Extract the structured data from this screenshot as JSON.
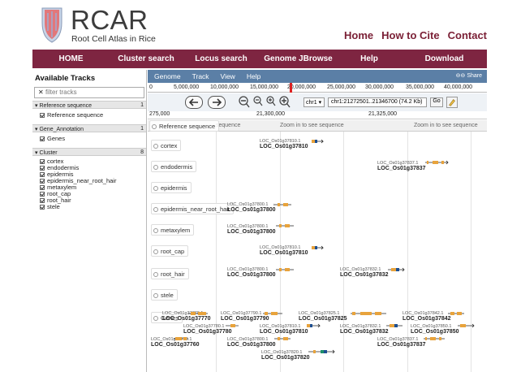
{
  "header": {
    "brand_title": "RCAR",
    "brand_subtitle": "Root Cell Atlas in Rice",
    "links": [
      "Home",
      "How to Cite",
      "Contact"
    ]
  },
  "nav": {
    "items": [
      "HOME",
      "Cluster search",
      "Locus search",
      "Genome JBrowse",
      "Help",
      "Download"
    ]
  },
  "tracks_panel": {
    "title": "Available Tracks",
    "filter_placeholder": "filter tracks",
    "categories": [
      {
        "name": "Reference sequence",
        "count": "1",
        "items": [
          "Reference sequence"
        ]
      },
      {
        "name": "Gene_Annotation",
        "count": "1",
        "items": [
          "Genes"
        ]
      },
      {
        "name": "Cluster",
        "count": "8",
        "items": [
          "cortex",
          "endodermis",
          "epidermis",
          "epidermis_near_root_hair",
          "metaxylem",
          "root_cap",
          "root_hair",
          "stele"
        ]
      }
    ]
  },
  "browser": {
    "menu": [
      "Genome",
      "Track",
      "View",
      "Help"
    ],
    "share_label": "Share",
    "overview_ticks": [
      "0",
      "5,000,000",
      "10,000,000",
      "15,000,000",
      "20,000,000",
      "25,000,000",
      "30,000,000",
      "35,000,000",
      "40,000,000"
    ],
    "chromosome": "chr1",
    "location": "chr1:21272501..21346700 (74.2 Kb)",
    "go_label": "Go",
    "ruler_ticks": [
      "275,000",
      "21,300,000",
      "21,325,000"
    ],
    "ref_row": {
      "label": "Reference sequence",
      "messages": [
        "sequence",
        "Zoom in to see sequence",
        "Zoom in to see sequence"
      ]
    },
    "tracks": [
      {
        "label": "cortex",
        "genes": [
          {
            "small": "LOC_Os01g37810.1",
            "big": "LOC_Os01g37810"
          }
        ]
      },
      {
        "label": "endodermis",
        "genes": [
          {
            "small": "LOC_Os01g37837.1",
            "big": "LOC_Os01g37837"
          }
        ]
      },
      {
        "label": "epidermis",
        "genes": []
      },
      {
        "label": "epidermis_near_root_hair",
        "genes": [
          {
            "small": "LOC_Os01g37800.1",
            "big": "LOC_Os01g37800"
          }
        ]
      },
      {
        "label": "metaxylem",
        "genes": [
          {
            "small": "LOC_Os01g37800.1",
            "big": "LOC_Os01g37800"
          }
        ]
      },
      {
        "label": "root_cap",
        "genes": [
          {
            "small": "LOC_Os01g37810.1",
            "big": "LOC_Os01g37810"
          }
        ]
      },
      {
        "label": "root_hair",
        "genes": [
          {
            "small": "LOC_Os01g37800.1",
            "big": "LOC_Os01g37800"
          },
          {
            "small": "LOC_Os01g37832.1",
            "big": "LOC_Os01g37832"
          }
        ]
      },
      {
        "label": "stele",
        "genes": []
      },
      {
        "label": "Genes",
        "genes": [
          {
            "small": "LOC_Os01g37770.1",
            "big": "LOC_Os01g37770"
          },
          {
            "small": "LOC_Os01g37790.1",
            "big": "LOC_Os01g37790"
          },
          {
            "small": "LOC_Os01g37825.1",
            "big": "LOC_Os01g37825"
          },
          {
            "small": "LOC_Os01g37842.1",
            "big": "LOC_Os01g37842"
          },
          {
            "small": "LOC_Os01g37780.1",
            "big": "LOC_Os01g37780"
          },
          {
            "small": "LOC_Os01g37810.1",
            "big": "LOC_Os01g37810"
          },
          {
            "small": "LOC_Os01g37832.1",
            "big": "LOC_Os01g37832"
          },
          {
            "small": "LOC_Os01g37850.1",
            "big": "LOC_Os01g37850"
          },
          {
            "small": "LOC_Os01g37760.1",
            "big": "LOC_Os01g37760"
          },
          {
            "small": "LOC_Os01g37800.1",
            "big": "LOC_Os01g37800"
          },
          {
            "small": "LOC_Os01g37837.1",
            "big": "LOC_Os01g37837"
          },
          {
            "small": "LOC_Os01g37820.1",
            "big": "LOC_Os01g37820"
          }
        ]
      }
    ]
  },
  "colors": {
    "nav_bg": "#7e2541",
    "menubar_bg": "#5b7fa6",
    "link_color": "#7a1f35",
    "gene_glyph": "#e8a33c",
    "gene_glyph_dark": "#1d4f91"
  }
}
